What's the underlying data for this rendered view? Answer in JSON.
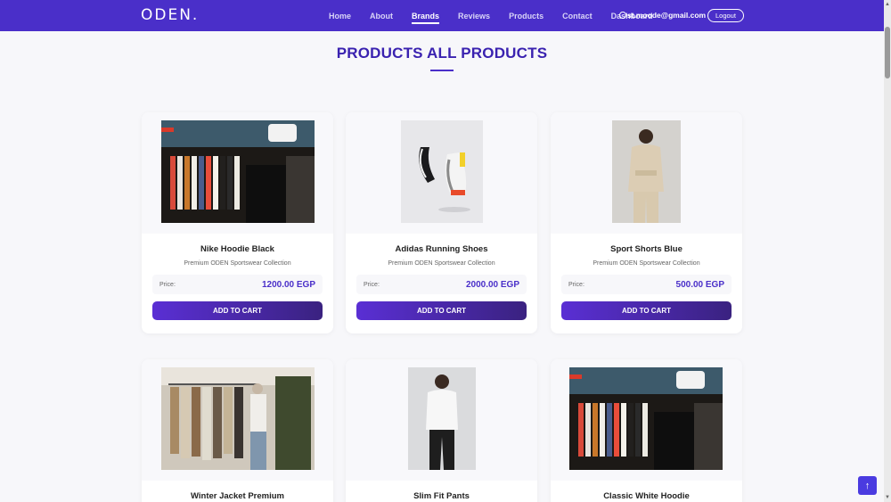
{
  "navbar": {
    "brand": "ODEN.",
    "links": [
      {
        "label": "Home"
      },
      {
        "label": "About"
      },
      {
        "label": "Brands"
      },
      {
        "label": "Reviews"
      },
      {
        "label": "Products"
      },
      {
        "label": "Contact"
      },
      {
        "label": "Dashboard"
      }
    ],
    "user_email": "st.moode@gmail.com",
    "logout_label": "Logout"
  },
  "page": {
    "title": "PRODUCTS ALL PRODUCTS"
  },
  "products": [
    {
      "name": "Nike Hoodie Black",
      "subtitle": "Premium ODEN Sportswear Collection",
      "price_label": "Price:",
      "price": "1200.00 EGP",
      "button": "ADD TO CART"
    },
    {
      "name": "Adidas Running Shoes",
      "subtitle": "Premium ODEN Sportswear Collection",
      "price_label": "Price:",
      "price": "2000.00 EGP",
      "button": "ADD TO CART"
    },
    {
      "name": "Sport Shorts Blue",
      "subtitle": "Premium ODEN Sportswear Collection",
      "price_label": "Price:",
      "price": "500.00 EGP",
      "button": "ADD TO CART"
    },
    {
      "name": "Winter Jacket Premium"
    },
    {
      "name": "Slim Fit Pants"
    },
    {
      "name": "Classic White Hoodie"
    }
  ],
  "icons": {
    "user": "user-icon",
    "to_top": "arrow-up-icon"
  },
  "colors": {
    "navbar": "#4a2fc9",
    "title": "#3a22b0",
    "price": "#4a2fc9"
  }
}
